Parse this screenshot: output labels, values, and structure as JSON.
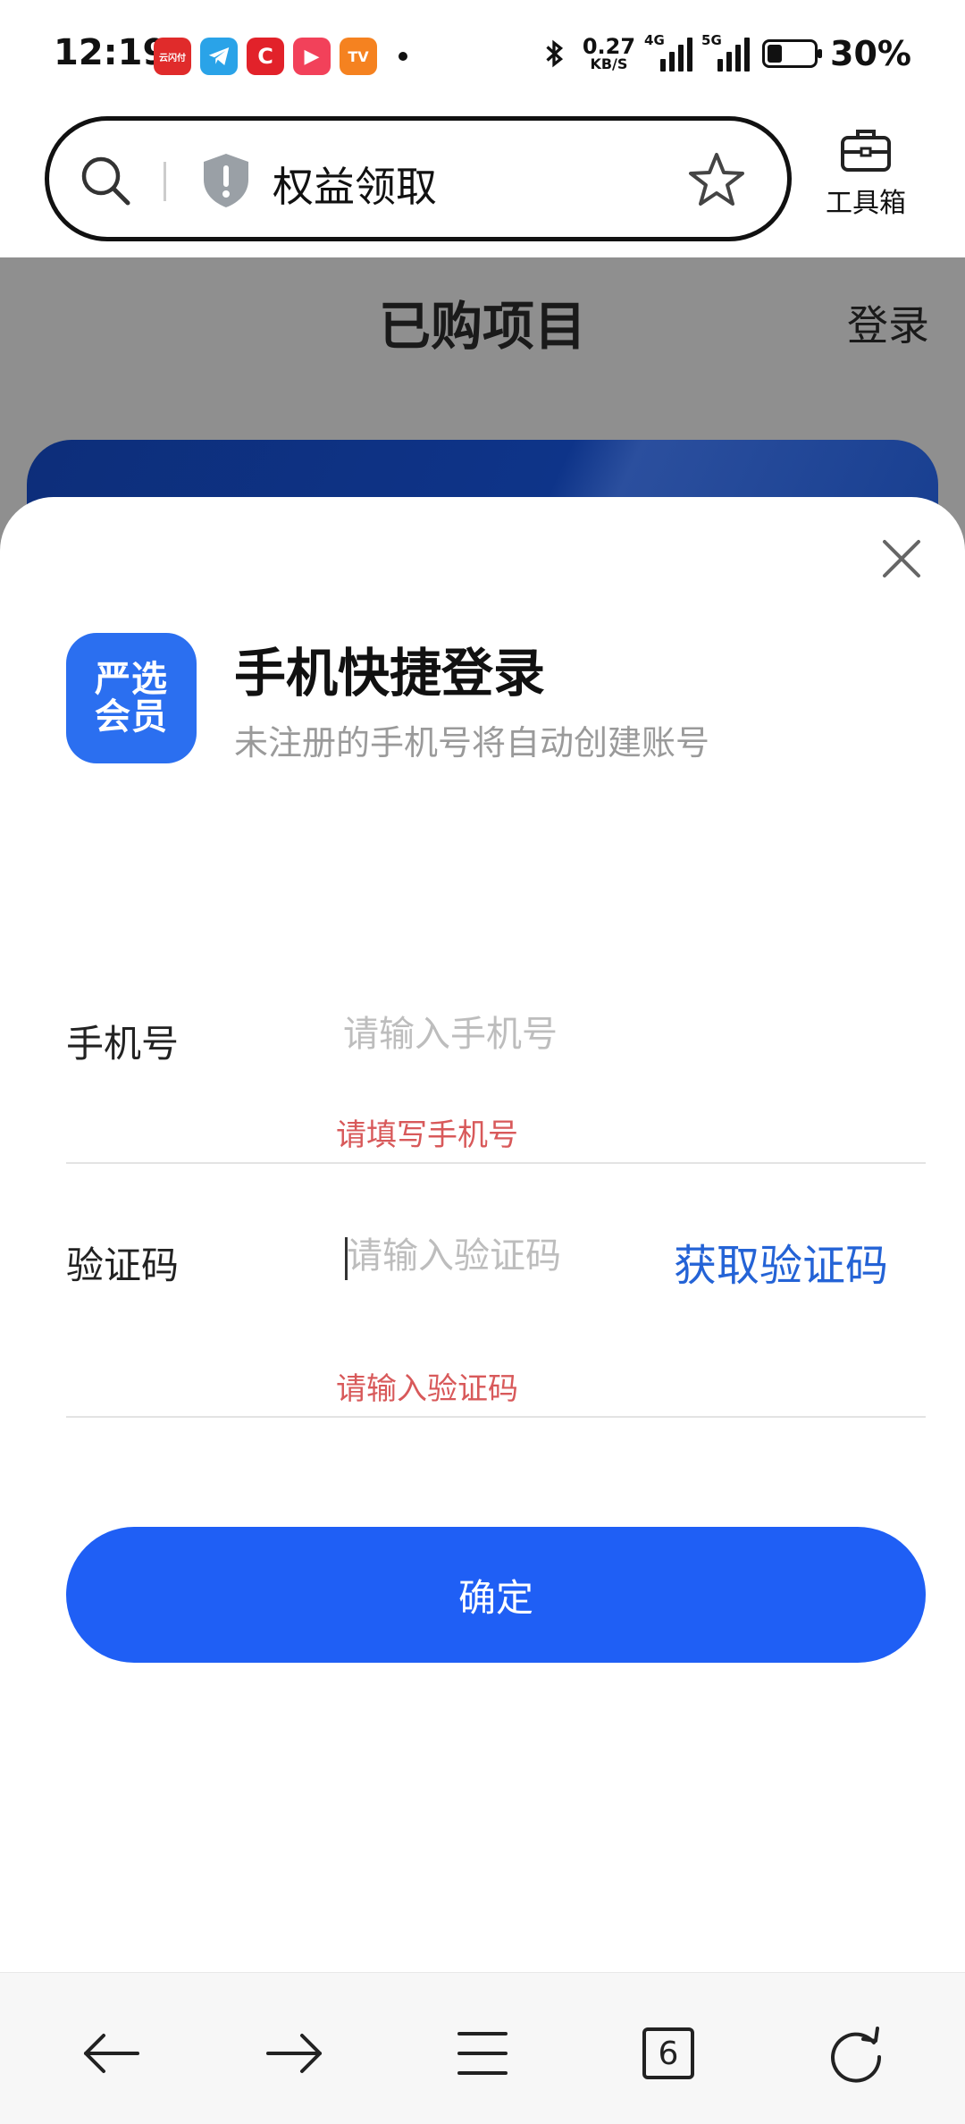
{
  "status_bar": {
    "time": "12:19",
    "net_speed_value": "0.27",
    "net_speed_unit": "KB/S",
    "signal_1_label": "4G",
    "signal_2_label": "5G",
    "battery_percent": "30%",
    "notification_icons": [
      {
        "name": "wallet-app-icon",
        "label": "云闪付",
        "color": "#e02b2b"
      },
      {
        "name": "telegram-app-icon",
        "label": "",
        "color": "#2aa3e8"
      },
      {
        "name": "c-app-icon",
        "label": "C",
        "color": "#e2222a"
      },
      {
        "name": "video-app-icon",
        "label": "▶",
        "color": "#f2415a"
      },
      {
        "name": "mgtv-app-icon",
        "label": "TV",
        "color": "#f58220"
      }
    ]
  },
  "browser": {
    "url_title": "权益领取",
    "toolbox_label": "工具箱"
  },
  "background_page": {
    "title": "已购项目",
    "login_link": "登录"
  },
  "login_sheet": {
    "logo_line1": "严选",
    "logo_line2": "会员",
    "title": "手机快捷登录",
    "subtitle": "未注册的手机号将自动创建账号",
    "phone_label": "手机号",
    "phone_placeholder": "请输入手机号",
    "phone_value": "",
    "phone_error": "请填写手机号",
    "code_label": "验证码",
    "code_placeholder": "请输入验证码",
    "code_value": "",
    "code_error": "请输入验证码",
    "get_code_label": "获取验证码",
    "confirm_label": "确定"
  },
  "bottom_nav": {
    "tab_count": "6"
  },
  "colors": {
    "accent": "#1f5ff5",
    "link": "#2463d6",
    "error": "#d8595a",
    "overlay": "#8f8f8f"
  }
}
